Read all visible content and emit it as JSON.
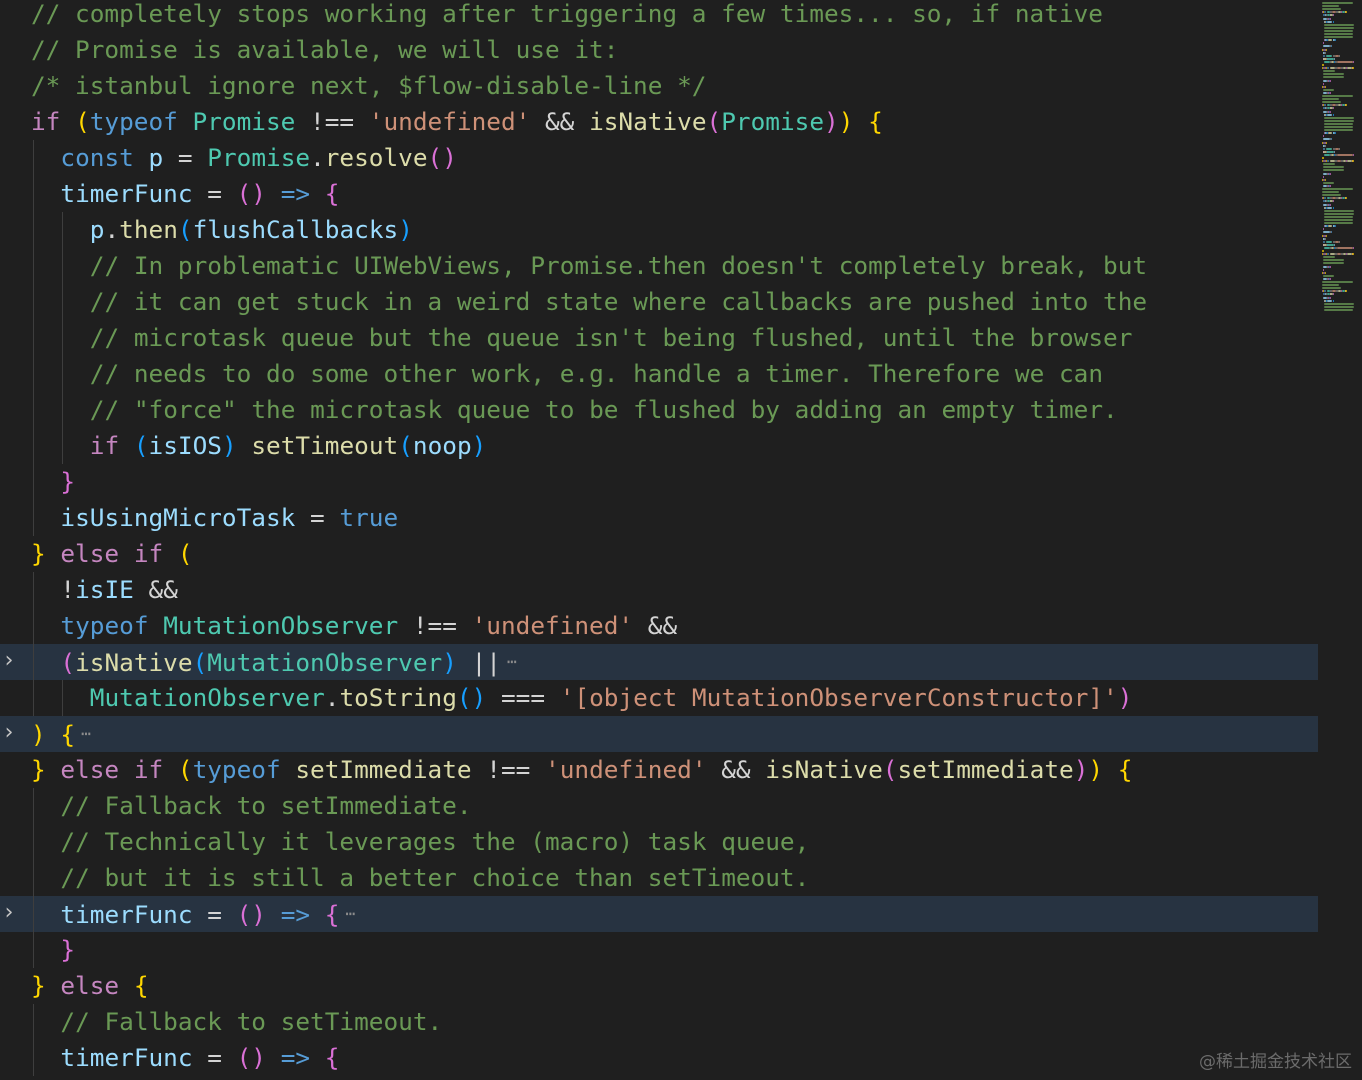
{
  "colors": {
    "background": "#1f1f1f",
    "line_highlight": "#273341",
    "keyword": "#569cd6",
    "control": "#c586c0",
    "type": "#4ec9b0",
    "variable": "#9cdcfe",
    "function": "#dcdcaa",
    "string": "#ce9178",
    "comment": "#6a9955",
    "bracket_1": "#ffd700",
    "bracket_2": "#da70d6",
    "bracket_3": "#179fff"
  },
  "icons": {
    "fold": "chevron-right-icon",
    "ellipsis": "ellipsis-icon"
  },
  "watermark": "@稀土掘金技术社区",
  "lines": [
    {
      "indent": 0,
      "tokens": [
        [
          "c-cmt",
          "// completely stops working after triggering a few times... so, if native"
        ]
      ]
    },
    {
      "indent": 0,
      "tokens": [
        [
          "c-cmt",
          "// Promise is available, we will use it:"
        ]
      ]
    },
    {
      "indent": 0,
      "tokens": [
        [
          "c-cmt",
          "/* istanbul ignore next, $flow-disable-line */"
        ]
      ]
    },
    {
      "indent": 0,
      "tokens": [
        [
          "c-ctl",
          "if"
        ],
        [
          "c-op",
          " "
        ],
        [
          "c-b1",
          "("
        ],
        [
          "c-kw",
          "typeof"
        ],
        [
          "c-op",
          " "
        ],
        [
          "c-type",
          "Promise"
        ],
        [
          "c-op",
          " !== "
        ],
        [
          "c-str",
          "'undefined'"
        ],
        [
          "c-op",
          " && "
        ],
        [
          "c-fn",
          "isNative"
        ],
        [
          "c-b2",
          "("
        ],
        [
          "c-type",
          "Promise"
        ],
        [
          "c-b2",
          ")"
        ],
        [
          "c-b1",
          ")"
        ],
        [
          "c-op",
          " "
        ],
        [
          "c-b1",
          "{"
        ]
      ]
    },
    {
      "indent": 1,
      "tokens": [
        [
          "c-kw",
          "const"
        ],
        [
          "c-op",
          " "
        ],
        [
          "c-var",
          "p"
        ],
        [
          "c-op",
          " = "
        ],
        [
          "c-type",
          "Promise"
        ],
        [
          "c-op",
          "."
        ],
        [
          "c-fn",
          "resolve"
        ],
        [
          "c-b2",
          "()"
        ]
      ]
    },
    {
      "indent": 1,
      "tokens": [
        [
          "c-var",
          "timerFunc"
        ],
        [
          "c-op",
          " = "
        ],
        [
          "c-b2",
          "()"
        ],
        [
          "c-op",
          " "
        ],
        [
          "c-kw",
          "=>"
        ],
        [
          "c-op",
          " "
        ],
        [
          "c-b2",
          "{"
        ]
      ]
    },
    {
      "indent": 2,
      "tokens": [
        [
          "c-var",
          "p"
        ],
        [
          "c-op",
          "."
        ],
        [
          "c-fn",
          "then"
        ],
        [
          "c-b3",
          "("
        ],
        [
          "c-var",
          "flushCallbacks"
        ],
        [
          "c-b3",
          ")"
        ]
      ]
    },
    {
      "indent": 2,
      "tokens": [
        [
          "c-cmt",
          "// In problematic UIWebViews, Promise.then doesn't completely break, but"
        ]
      ]
    },
    {
      "indent": 2,
      "tokens": [
        [
          "c-cmt",
          "// it can get stuck in a weird state where callbacks are pushed into the"
        ]
      ]
    },
    {
      "indent": 2,
      "tokens": [
        [
          "c-cmt",
          "// microtask queue but the queue isn't being flushed, until the browser"
        ]
      ]
    },
    {
      "indent": 2,
      "tokens": [
        [
          "c-cmt",
          "// needs to do some other work, e.g. handle a timer. Therefore we can"
        ]
      ]
    },
    {
      "indent": 2,
      "tokens": [
        [
          "c-cmt",
          "// \"force\" the microtask queue to be flushed by adding an empty timer."
        ]
      ]
    },
    {
      "indent": 2,
      "tokens": [
        [
          "c-ctl",
          "if"
        ],
        [
          "c-op",
          " "
        ],
        [
          "c-b3",
          "("
        ],
        [
          "c-var",
          "isIOS"
        ],
        [
          "c-b3",
          ")"
        ],
        [
          "c-op",
          " "
        ],
        [
          "c-fn",
          "setTimeout"
        ],
        [
          "c-b3",
          "("
        ],
        [
          "c-var",
          "noop"
        ],
        [
          "c-b3",
          ")"
        ]
      ]
    },
    {
      "indent": 1,
      "tokens": [
        [
          "c-b2",
          "}"
        ]
      ]
    },
    {
      "indent": 1,
      "tokens": [
        [
          "c-var",
          "isUsingMicroTask"
        ],
        [
          "c-op",
          " = "
        ],
        [
          "c-kw",
          "true"
        ]
      ]
    },
    {
      "indent": 0,
      "tokens": [
        [
          "c-b1",
          "}"
        ],
        [
          "c-op",
          " "
        ],
        [
          "c-ctl",
          "else"
        ],
        [
          "c-op",
          " "
        ],
        [
          "c-ctl",
          "if"
        ],
        [
          "c-op",
          " "
        ],
        [
          "c-b1",
          "("
        ]
      ]
    },
    {
      "indent": 1,
      "tokens": [
        [
          "c-op",
          "!"
        ],
        [
          "c-var",
          "isIE"
        ],
        [
          "c-op",
          " &&"
        ]
      ]
    },
    {
      "indent": 1,
      "tokens": [
        [
          "c-kw",
          "typeof"
        ],
        [
          "c-op",
          " "
        ],
        [
          "c-type",
          "MutationObserver"
        ],
        [
          "c-op",
          " !== "
        ],
        [
          "c-str",
          "'undefined'"
        ],
        [
          "c-op",
          " &&"
        ]
      ]
    },
    {
      "indent": 1,
      "hl": true,
      "fold": true,
      "ellipsis": "⋯",
      "tokens": [
        [
          "c-b2",
          "("
        ],
        [
          "c-fn",
          "isNative"
        ],
        [
          "c-b3",
          "("
        ],
        [
          "c-type",
          "MutationObserver"
        ],
        [
          "c-b3",
          ")"
        ],
        [
          "c-op",
          " ||"
        ]
      ]
    },
    {
      "indent": 2,
      "tokens": [
        [
          "c-type",
          "MutationObserver"
        ],
        [
          "c-op",
          "."
        ],
        [
          "c-fn",
          "toString"
        ],
        [
          "c-b3",
          "()"
        ],
        [
          "c-op",
          " === "
        ],
        [
          "c-str",
          "'[object MutationObserverConstructor]'"
        ],
        [
          "c-b2",
          ")"
        ]
      ]
    },
    {
      "indent": 0,
      "hl": true,
      "fold": true,
      "ellipsis": "⋯",
      "tokens": [
        [
          "c-b1",
          ")"
        ],
        [
          "c-op",
          " "
        ],
        [
          "c-b1",
          "{"
        ]
      ]
    },
    {
      "indent": 0,
      "tokens": [
        [
          "c-b1",
          "}"
        ],
        [
          "c-op",
          " "
        ],
        [
          "c-ctl",
          "else"
        ],
        [
          "c-op",
          " "
        ],
        [
          "c-ctl",
          "if"
        ],
        [
          "c-op",
          " "
        ],
        [
          "c-b1",
          "("
        ],
        [
          "c-kw",
          "typeof"
        ],
        [
          "c-op",
          " "
        ],
        [
          "c-fn",
          "setImmediate"
        ],
        [
          "c-op",
          " !== "
        ],
        [
          "c-str",
          "'undefined'"
        ],
        [
          "c-op",
          " && "
        ],
        [
          "c-fn",
          "isNative"
        ],
        [
          "c-b2",
          "("
        ],
        [
          "c-fn",
          "setImmediate"
        ],
        [
          "c-b2",
          ")"
        ],
        [
          "c-b1",
          ")"
        ],
        [
          "c-op",
          " "
        ],
        [
          "c-b1",
          "{"
        ]
      ]
    },
    {
      "indent": 1,
      "tokens": [
        [
          "c-cmt",
          "// Fallback to setImmediate."
        ]
      ]
    },
    {
      "indent": 1,
      "tokens": [
        [
          "c-cmt",
          "// Technically it leverages the (macro) task queue,"
        ]
      ]
    },
    {
      "indent": 1,
      "tokens": [
        [
          "c-cmt",
          "// but it is still a better choice than setTimeout."
        ]
      ]
    },
    {
      "indent": 1,
      "hl": true,
      "fold": true,
      "ellipsis": "⋯",
      "tokens": [
        [
          "c-var",
          "timerFunc"
        ],
        [
          "c-op",
          " = "
        ],
        [
          "c-b2",
          "()"
        ],
        [
          "c-op",
          " "
        ],
        [
          "c-kw",
          "=>"
        ],
        [
          "c-op",
          " "
        ],
        [
          "c-b2",
          "{"
        ]
      ]
    },
    {
      "indent": 1,
      "tokens": [
        [
          "c-b2",
          "}"
        ]
      ]
    },
    {
      "indent": 0,
      "tokens": [
        [
          "c-b1",
          "}"
        ],
        [
          "c-op",
          " "
        ],
        [
          "c-ctl",
          "else"
        ],
        [
          "c-op",
          " "
        ],
        [
          "c-b1",
          "{"
        ]
      ]
    },
    {
      "indent": 1,
      "tokens": [
        [
          "c-cmt",
          "// Fallback to setTimeout."
        ]
      ]
    },
    {
      "indent": 1,
      "tokens": [
        [
          "c-var",
          "timerFunc"
        ],
        [
          "c-op",
          " = "
        ],
        [
          "c-b2",
          "()"
        ],
        [
          "c-op",
          " "
        ],
        [
          "c-kw",
          "=>"
        ],
        [
          "c-op",
          " "
        ],
        [
          "c-b2",
          "{"
        ]
      ]
    }
  ]
}
